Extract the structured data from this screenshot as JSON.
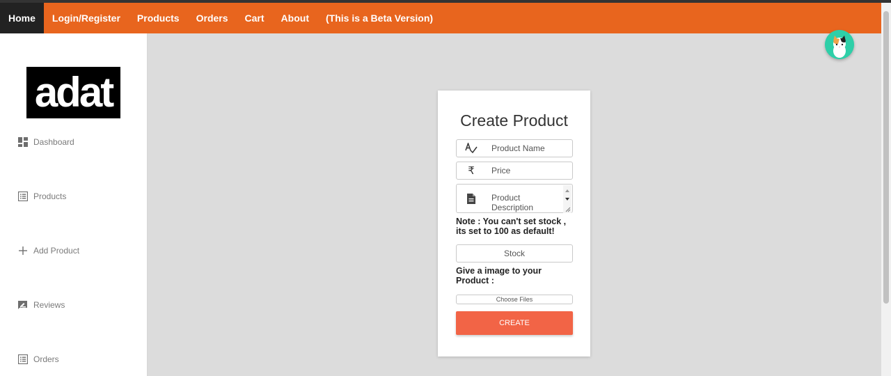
{
  "nav": {
    "items": [
      {
        "label": "Home",
        "active": true
      },
      {
        "label": "Login/Register"
      },
      {
        "label": "Products"
      },
      {
        "label": "Orders"
      },
      {
        "label": "Cart"
      },
      {
        "label": "About"
      },
      {
        "label": "(This is a Beta Version)"
      }
    ]
  },
  "sidebar": {
    "logo_text": "adat",
    "items": [
      {
        "label": "Dashboard",
        "icon": "dashboard-icon"
      },
      {
        "label": "Products",
        "icon": "list-icon"
      },
      {
        "label": "Add Product",
        "icon": "plus-icon"
      },
      {
        "label": "Reviews",
        "icon": "rate-review-icon"
      },
      {
        "label": "Orders",
        "icon": "list-icon"
      }
    ]
  },
  "form": {
    "title": "Create Product",
    "name_placeholder": "Product Name",
    "price_placeholder": "Price",
    "price_symbol": "₹",
    "description_placeholder": "Product Description",
    "note": "Note : You can't set stock , its set to 100 as default!",
    "stock_placeholder": "Stock",
    "image_label": "Give a image to your Product :",
    "file_label": "Choose Files",
    "submit_label": "CREATE"
  },
  "colors": {
    "nav_bg": "#e8651e",
    "nav_active_bg": "#222222",
    "button_bg": "#f26446",
    "page_bg": "#dcdcdc",
    "avatar_bg": "#2ecfa8"
  }
}
